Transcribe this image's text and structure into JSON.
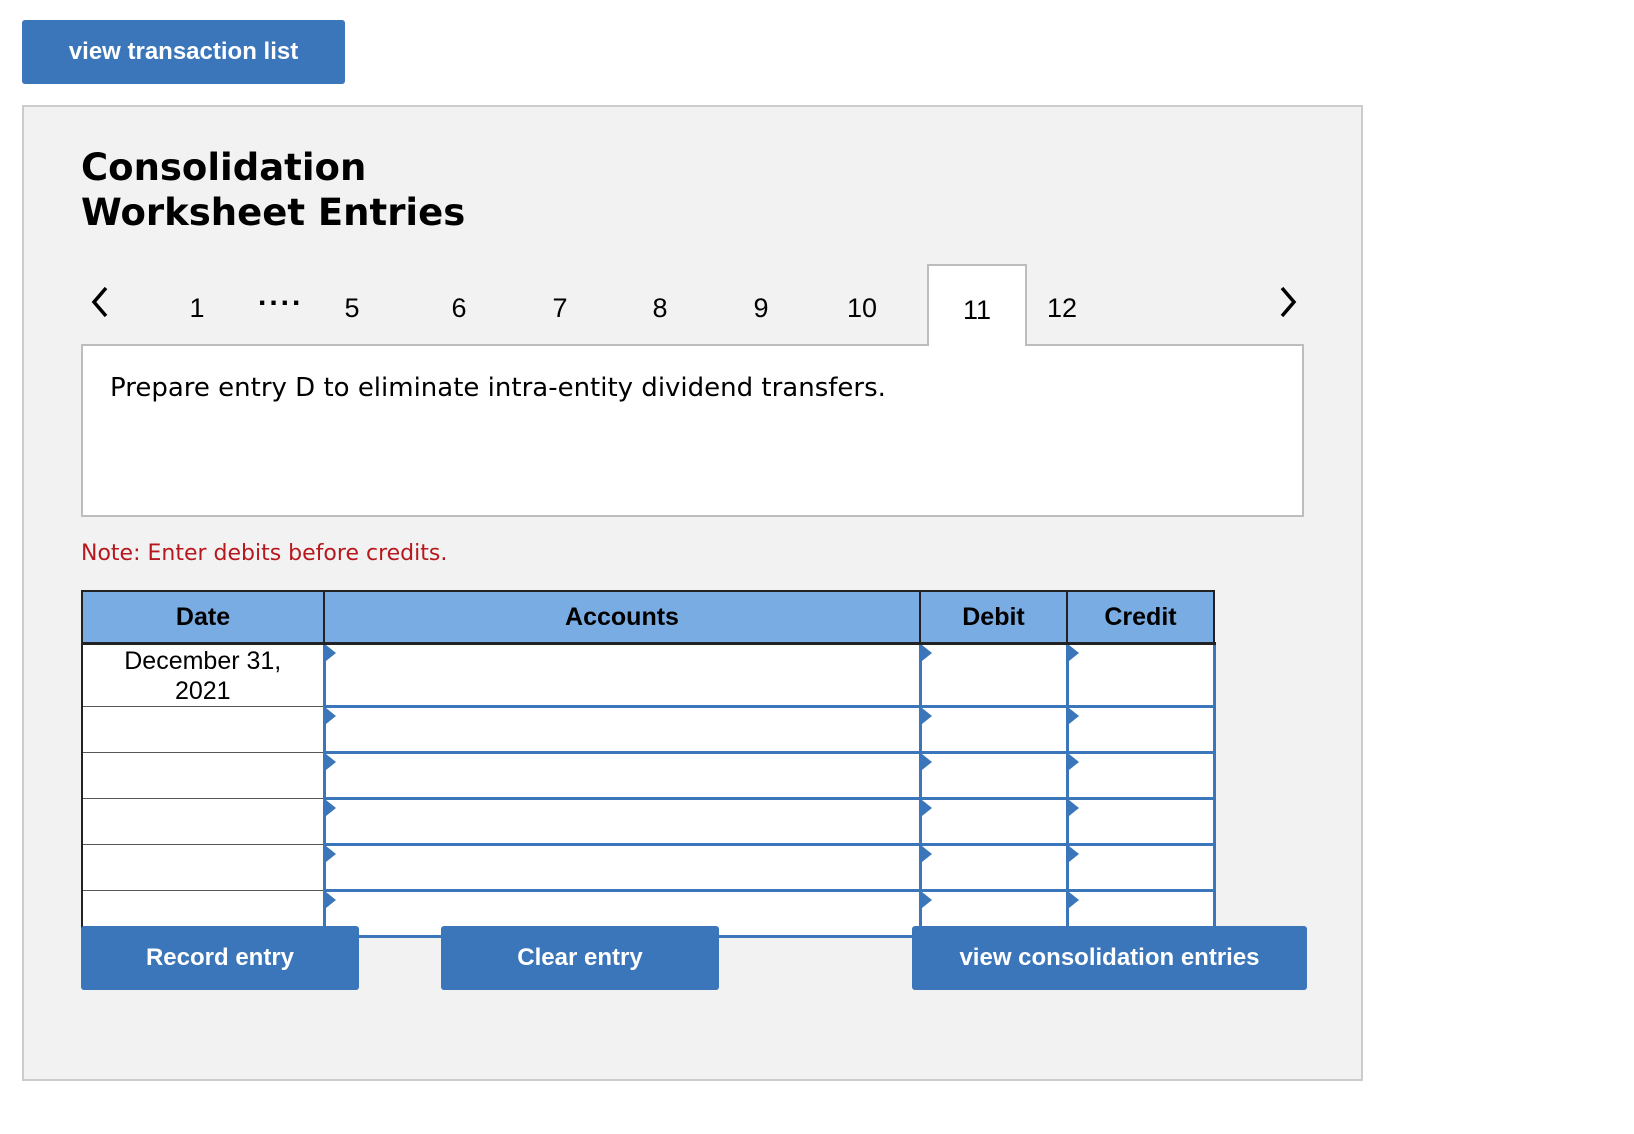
{
  "top_button_label": "view transaction list",
  "panel": {
    "title_line1": "Consolidation",
    "title_line2": "Worksheet Entries",
    "tabs": [
      "1",
      "5",
      "6",
      "7",
      "8",
      "9",
      "10",
      "11",
      "12"
    ],
    "dots": "....",
    "active_tab": "11",
    "prompt": "Prepare entry D to eliminate intra-entity dividend transfers.",
    "note": "Note: Enter debits before credits.",
    "table": {
      "headers": {
        "date": "Date",
        "accounts": "Accounts",
        "debit": "Debit",
        "credit": "Credit"
      },
      "rows": [
        {
          "date_line1": "December 31,",
          "date_line2": "2021"
        },
        {
          "date_line1": "",
          "date_line2": ""
        },
        {
          "date_line1": "",
          "date_line2": ""
        },
        {
          "date_line1": "",
          "date_line2": ""
        },
        {
          "date_line1": "",
          "date_line2": ""
        },
        {
          "date_line1": "",
          "date_line2": ""
        }
      ]
    },
    "buttons": {
      "record": "Record entry",
      "clear": "Clear entry",
      "view": "view consolidation entries"
    }
  },
  "colors": {
    "button_blue": "#3a76b9",
    "header_blue": "#79ace3",
    "note_red": "#b7181e",
    "panel_bg": "#f2f2f2"
  },
  "icons": {
    "prev": "chevron-left-icon",
    "next": "chevron-right-icon",
    "cell_marker": "blue-triangle-marker-icon"
  }
}
